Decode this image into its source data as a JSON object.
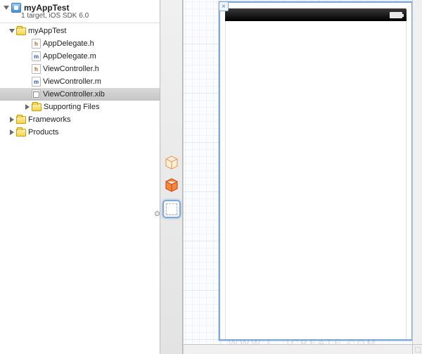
{
  "project": {
    "name": "myAppTest",
    "subtitle": "1 target, iOS SDK 6.0"
  },
  "tree": {
    "root": {
      "label": "myAppTest",
      "children": {
        "appdelegate_h": "AppDelegate.h",
        "appdelegate_m": "AppDelegate.m",
        "viewcontroller_h": "ViewController.h",
        "viewcontroller_m": "ViewController.m",
        "viewcontroller_xib": "ViewController.xib",
        "supporting": "Supporting Files"
      }
    },
    "frameworks": "Frameworks",
    "products": "Products"
  },
  "dock": {
    "files_owner": "files-owner",
    "first_responder": "first-responder",
    "view": "view"
  },
  "watermark": "WWW.[...]CREATE.COM"
}
